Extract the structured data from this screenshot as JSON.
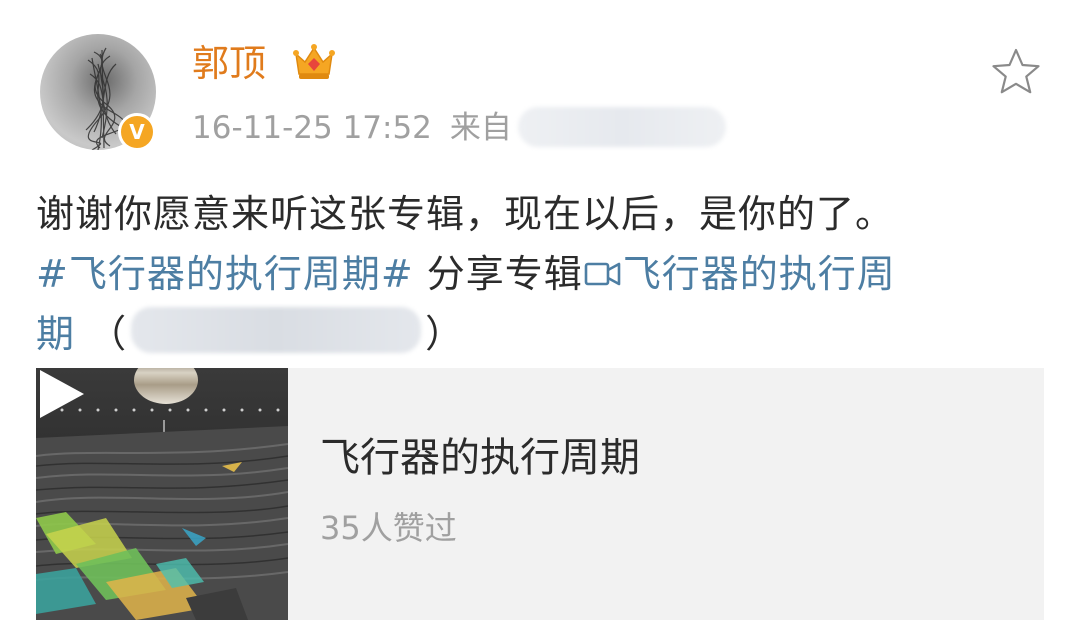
{
  "post": {
    "author": {
      "name": "郭顶",
      "verified_mark": "V",
      "avatar_icon": "avatar-image",
      "badge_icon": "crown-icon"
    },
    "time": "16-11-25 17:52",
    "source_prefix": "来自",
    "favorite_icon": "star-icon",
    "text": {
      "line1": "谢谢你愿意来听这张专辑，现在以后，是你的了。",
      "hashtag": "#飞行器的执行周期#",
      "share_prefix": "分享专辑",
      "music_icon": "music-link-icon",
      "album_link_part1": "飞行器的执行周",
      "album_link_part2": "期",
      "paren_open": "（",
      "paren_close": "）"
    },
    "card": {
      "title": "飞行器的执行周期",
      "subtitle": "35人赞过",
      "play_icon": "play-icon"
    }
  },
  "colors": {
    "username": "#e07b1c",
    "link": "#4d7ea3",
    "meta_gray": "#a0a0a0",
    "badge": "#f5a623",
    "card_bg": "#f2f2f2"
  }
}
